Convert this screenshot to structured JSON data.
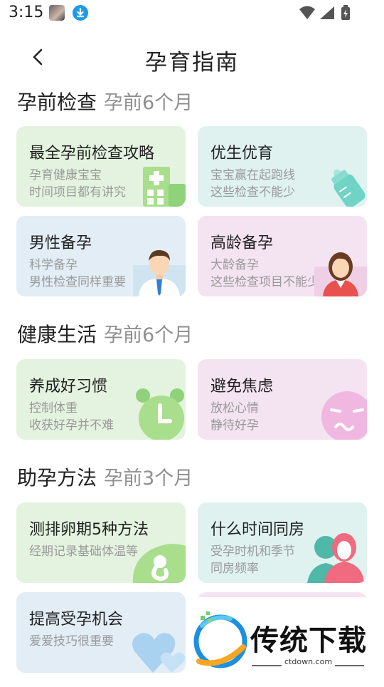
{
  "status": {
    "time": "3:15"
  },
  "header": {
    "title": "孕育指南"
  },
  "sections": [
    {
      "title": "孕前检查",
      "subtitle": "孕前6个月",
      "cards": [
        {
          "title": "最全孕前检查攻略",
          "line1": "孕育健康宝宝",
          "line2": "时间项目都有讲究",
          "icon": "hospital-icon"
        },
        {
          "title": "优生优育",
          "line1": "宝宝赢在起跑线",
          "line2": "这些检查不能少",
          "icon": "baby-bottle-icon"
        },
        {
          "title": "男性备孕",
          "line1": "科学备孕",
          "line2": "男性检查同样重要",
          "icon": "man-avatar-icon"
        },
        {
          "title": "高龄备孕",
          "line1": "大龄备孕",
          "line2": "这些检查项目不能少",
          "icon": "woman-avatar-icon"
        }
      ]
    },
    {
      "title": "健康生活",
      "subtitle": "孕前6个月",
      "cards": [
        {
          "title": "养成好习惯",
          "line1": "控制体重",
          "line2": "收获好孕并不难",
          "icon": "alarm-clock-icon"
        },
        {
          "title": "避免焦虑",
          "line1": "放松心情",
          "line2": "静待好孕",
          "icon": "worried-face-icon"
        }
      ]
    },
    {
      "title": "助孕方法",
      "subtitle": "孕前3个月",
      "cards": [
        {
          "title": "测排卵期5种方法",
          "line1": "经期记录基础体温等",
          "line2": "",
          "icon": "fetus-icon"
        },
        {
          "title": "什么时间同房",
          "line1": "受孕时机和季节",
          "line2": "同房频率",
          "icon": "couple-icon"
        },
        {
          "title": "提高受孕机会",
          "line1": "爱爱技巧很重要",
          "line2": "",
          "icon": "heart-icon"
        }
      ]
    }
  ],
  "watermark": {
    "name": "传统下载",
    "site": "ctdown.com"
  },
  "colors": {
    "green_card": "#e4f3df",
    "teal_card": "#dff2ef",
    "blue_card": "#e2edf5",
    "pink_card": "#f4e3f1",
    "subtitle_gray": "#8f8f8f"
  }
}
